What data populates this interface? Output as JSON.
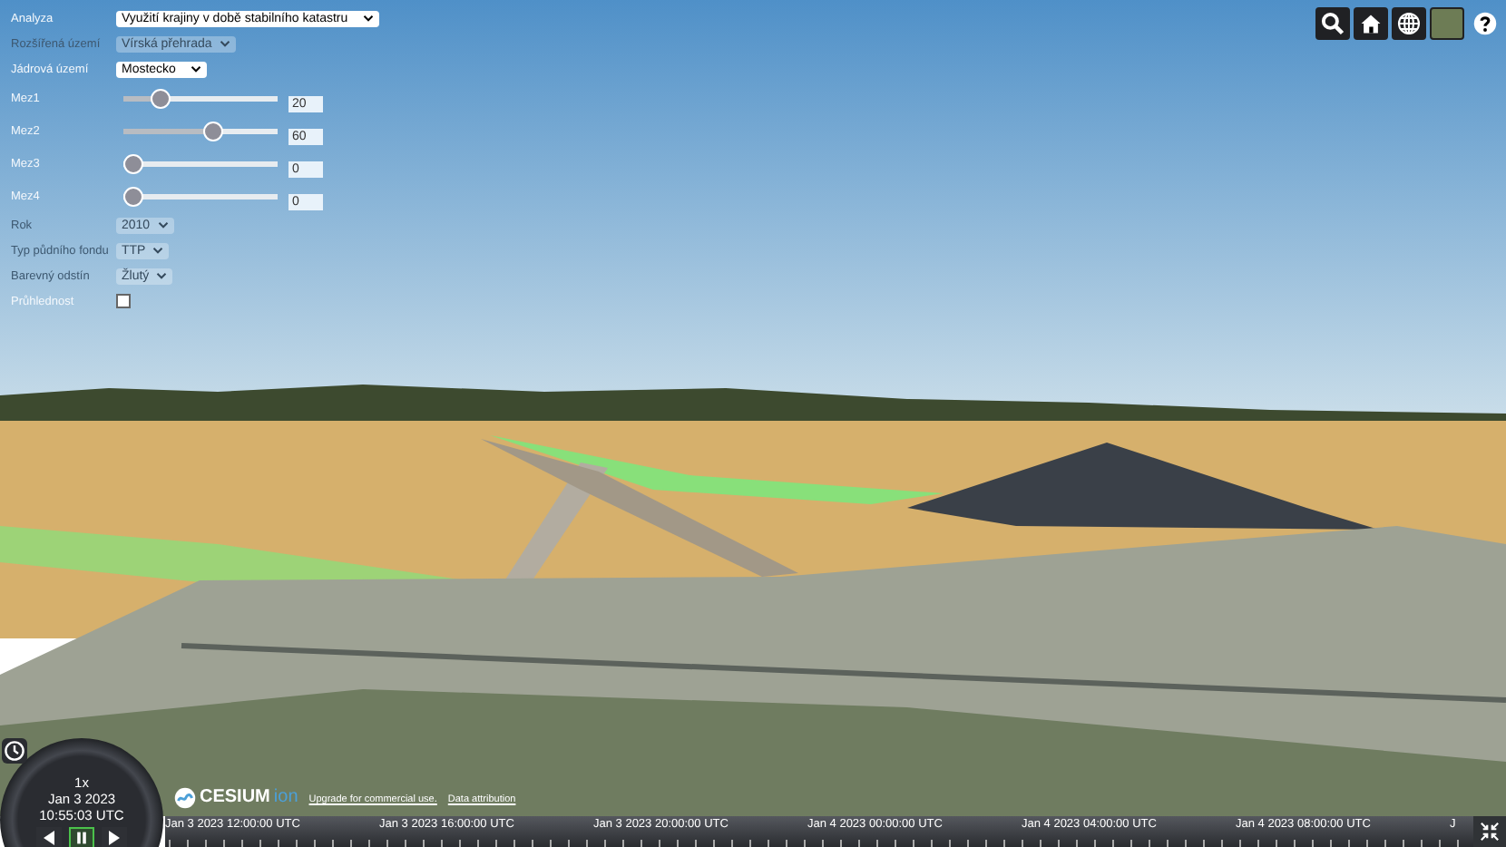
{
  "controls": [
    {
      "kind": "select",
      "label": "Analyza",
      "value": "Využití krajiny v době stabilního katastru",
      "disabled": false
    },
    {
      "kind": "select",
      "label": "Rozšířená území",
      "value": "Vírská přehrada",
      "disabled": true
    },
    {
      "kind": "select",
      "label": "Jádrová území",
      "value": "Mostecko",
      "disabled": false
    },
    {
      "kind": "slider",
      "label": "Mez1",
      "level": 0.2,
      "value": "20"
    },
    {
      "kind": "slider",
      "label": "Mez2",
      "level": 0.6,
      "value": "60"
    },
    {
      "kind": "slider",
      "label": "Mez3",
      "level": 0,
      "value": "0"
    },
    {
      "kind": "slider",
      "label": "Mez4",
      "level": 0,
      "value": "0"
    },
    {
      "kind": "select",
      "label": "Rok",
      "value": "2010",
      "disabled": true
    },
    {
      "kind": "select",
      "label": "Typ půdního fondu",
      "value": "TTP",
      "disabled": true
    },
    {
      "kind": "select",
      "label": "Barevný odstín",
      "value": "Žlutý",
      "disabled": true
    },
    {
      "kind": "checkbox",
      "label": "Průhlednost",
      "checked": false
    }
  ],
  "animation": {
    "speed": "1x",
    "date": "Jan 3 2023",
    "time": "10:55:03 UTC",
    "playing": true
  },
  "credits": {
    "logo": "CESIUM",
    "logo_suffix": "ion",
    "upgrade": "Upgrade for commercial use.",
    "attribution": "Data attribution"
  },
  "timeline": {
    "labels": [
      "Jan 3 2023 12:00:00 UTC",
      "Jan 3 2023 16:00:00 UTC",
      "Jan 3 2023 20:00:00 UTC",
      "Jan 4 2023 00:00:00 UTC",
      "Jan 4 2023 04:00:00 UTC",
      "Jan 4 2023 08:00:00 UTC",
      "J"
    ]
  }
}
